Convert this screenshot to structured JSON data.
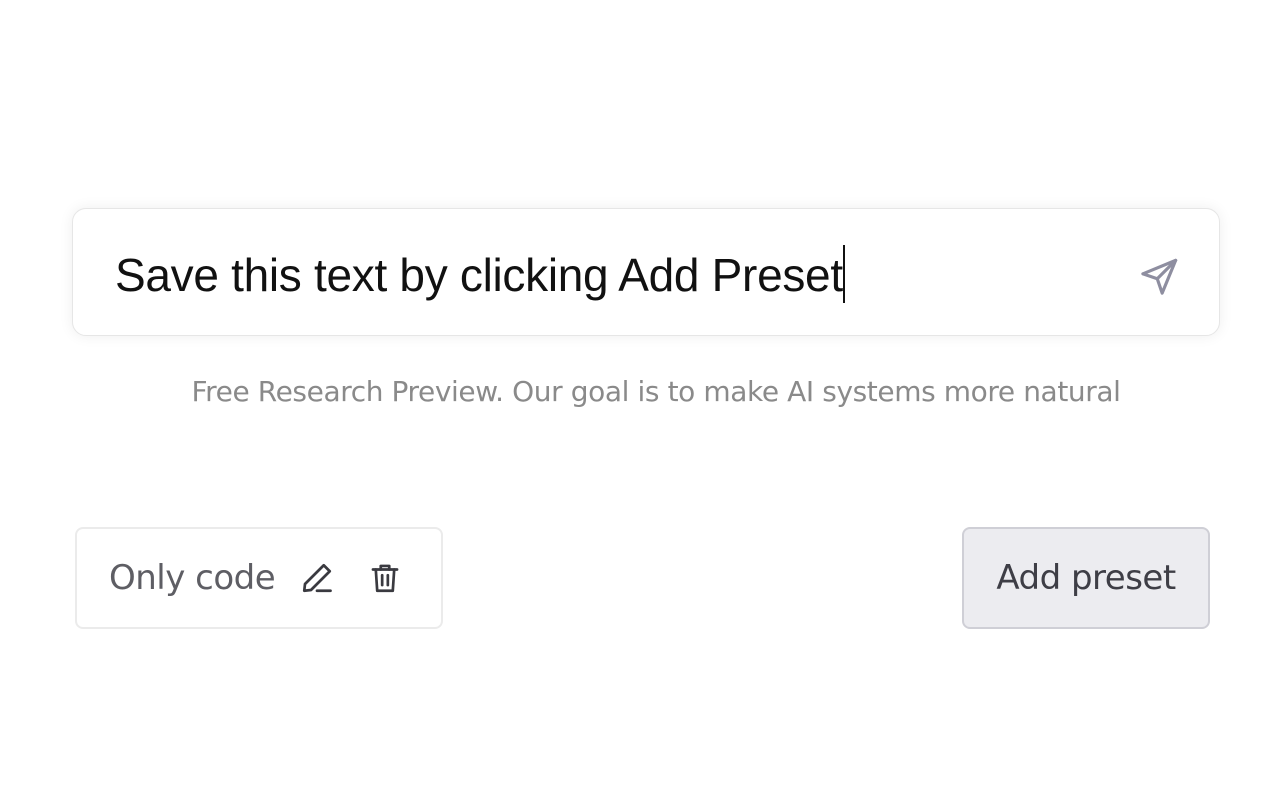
{
  "prompt": {
    "value": "Save this text by clicking Add Preset",
    "send_icon": "send-icon"
  },
  "disclaimer": {
    "text": "Free Research Preview. Our goal is to make AI systems more natural"
  },
  "presets": [
    {
      "label": "Only code",
      "edit_icon": "pencil-icon",
      "delete_icon": "trash-icon"
    }
  ],
  "actions": {
    "add_preset_label": "Add preset"
  },
  "colors": {
    "input_text": "#111111",
    "disclaimer_text": "#8a8a8a",
    "chip_text": "#5e5e64",
    "button_background": "#ececf0",
    "button_border": "#cfcfd6",
    "icon_stroke": "#8e8ea0"
  }
}
